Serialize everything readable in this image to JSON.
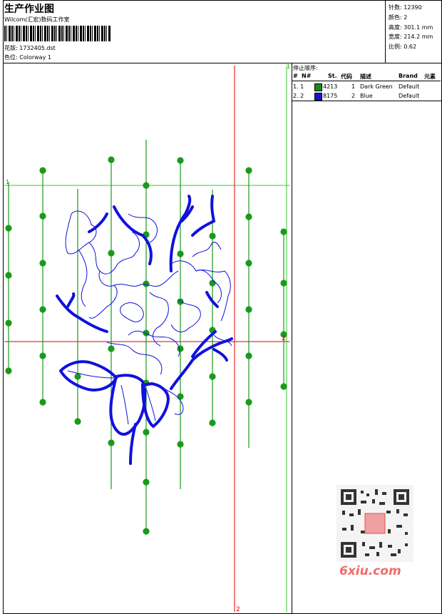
{
  "header": {
    "title": "生产作业图",
    "company": "Wilcom(汇宏)数码工作室",
    "design_label": "花版:",
    "design_file": "1732405.dst",
    "color_label": "色位:",
    "colorway": "Colorway 1"
  },
  "meta": {
    "stitches_label": "针数:",
    "stitches": "12390",
    "colors_label": "颜色:",
    "colors": "2",
    "height_label": "高度:",
    "height": "301.1 mm",
    "width_label": "宽度:",
    "width": "214.2 mm",
    "scale_label": "比例:",
    "scale": "0.62"
  },
  "stop_sequence": {
    "title": "停止顺序:",
    "columns": [
      "#",
      "N#",
      "St.",
      "代码",
      "描述",
      "Brand",
      "元素"
    ],
    "rows": [
      {
        "index": "1. 1",
        "swatch": "#1a8a1a",
        "code": "4213",
        "num": "1",
        "desc": "Dark Green",
        "brand": "Default"
      },
      {
        "index": "2. 2",
        "swatch": "#1414d8",
        "code": "8175",
        "num": "2",
        "desc": "Blue",
        "brand": "Default"
      }
    ]
  },
  "guides": {
    "marker_1": "1",
    "marker_2": "2"
  },
  "watermark": "6xiu.com",
  "colors": {
    "green": "#1a9a1a",
    "blue": "#1010e0",
    "red": "#e00000"
  }
}
